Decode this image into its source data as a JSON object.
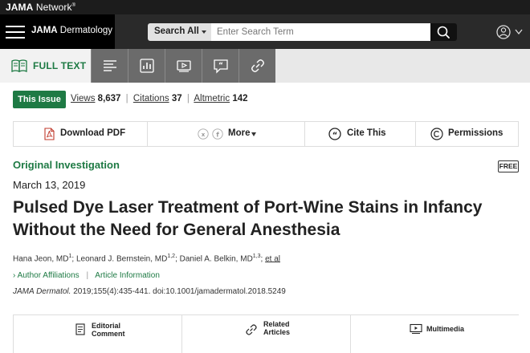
{
  "network": {
    "brand": "JAMA",
    "suffix": " Network",
    "trademark": "®"
  },
  "journal": {
    "brand": "JAMA",
    "name": " Dermatology"
  },
  "search": {
    "scope": "Search All",
    "placeholder": "Enter Search Term"
  },
  "nav": {
    "full_text_label": "FULL TEXT",
    "tabs": [
      "outline-icon",
      "figures-icon",
      "multimedia-icon",
      "comments-icon",
      "related-links-icon"
    ]
  },
  "issue_bar": {
    "this_issue": "This Issue",
    "views_label": "Views",
    "views_value": "8,637",
    "citations_label": "Citations",
    "citations_value": "37",
    "altmetric_label": "Altmetric",
    "altmetric_value": "142",
    "separator": "|"
  },
  "actions": {
    "download_pdf": "Download PDF",
    "more": "More",
    "cite_this": "Cite This",
    "permissions": "Permissions"
  },
  "article": {
    "type": "Original Investigation",
    "free_badge": "FREE",
    "date": "March 13, 2019",
    "title": "Pulsed Dye Laser Treatment of Port-Wine Stains in Infancy Without the Need for General Anesthesia",
    "authors": [
      {
        "name": "Hana Jeon, MD",
        "sup": "1"
      },
      {
        "name": "Leonard J. Bernstein, MD",
        "sup": "1,2"
      },
      {
        "name": "Daniel A. Belkin, MD",
        "sup": "1,3"
      }
    ],
    "et_al": "et al",
    "author_affiliations": "Author Affiliations",
    "article_information": "Article Information",
    "journal_abbrev": "JAMA Dermatol.",
    "citation": " 2019;155(4):435-441. doi:10.1001/jamadermatol.2018.5249"
  },
  "related": {
    "editorial_line1": "Editorial",
    "editorial_line2": "Comment",
    "related_line1": "Related",
    "related_line2": "Articles",
    "multimedia": "Multimedia"
  },
  "colors": {
    "brand_green": "#1e7a44",
    "header_dark": "#2a2a2a",
    "nav_gray": "#6b6b6b"
  }
}
